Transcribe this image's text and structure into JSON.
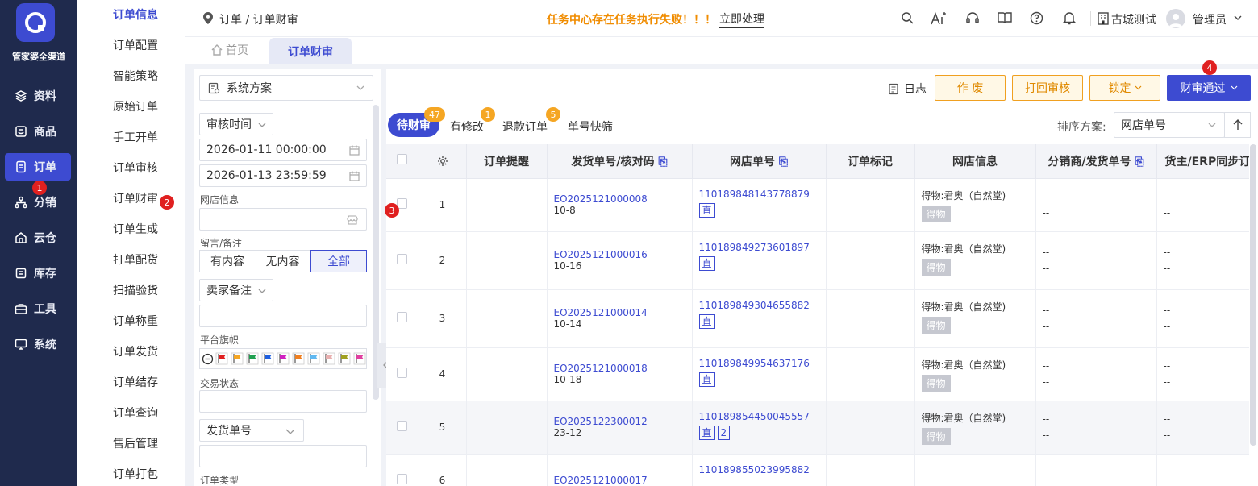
{
  "brand": {
    "name": "管家婆全渠道"
  },
  "nav": [
    {
      "label": "资料",
      "icon": "layers-icon"
    },
    {
      "label": "商品",
      "icon": "box-icon"
    },
    {
      "label": "订单",
      "icon": "document-icon",
      "active": true
    },
    {
      "label": "分销",
      "icon": "network-icon"
    },
    {
      "label": "云仓",
      "icon": "warehouse-icon"
    },
    {
      "label": "库存",
      "icon": "stack-icon"
    },
    {
      "label": "工具",
      "icon": "toolbox-icon"
    },
    {
      "label": "系统",
      "icon": "monitor-icon"
    }
  ],
  "badges": {
    "nav": "1",
    "submenu": "2",
    "row": "3",
    "approve": "4"
  },
  "submenu": [
    "订单信息",
    "订单配置",
    "智能策略",
    "原始订单",
    "手工开单",
    "订单审核",
    "订单财审",
    "订单生成",
    "打单配货",
    "扫描验货",
    "订单称重",
    "订单发货",
    "订单结存",
    "订单查询",
    "售后管理",
    "订单打包"
  ],
  "header": {
    "breadcrumb": "订单 / 订单财审",
    "alert": "任务中心存在任务执行失败！！！",
    "alert_action": "立即处理",
    "store": "古城测试",
    "user": "管理员"
  },
  "tabs": {
    "home": "首页",
    "current": "订单财审"
  },
  "filter": {
    "scheme": "系统方案",
    "time_type": "审核时间",
    "start": "2026-01-11 00:00:00",
    "end": "2026-01-13 23:59:59",
    "shop_label": "网店信息",
    "remark_label": "留言/备注",
    "remark_options": [
      "有内容",
      "无内容",
      "全部"
    ],
    "remark_selected": "全部",
    "seller_note": "卖家备注",
    "flag_label": "平台旗帜",
    "flag_colors": [
      "#e02020",
      "#f5a623",
      "#20a050",
      "#2060e0",
      "#d020c0",
      "#f08020",
      "#60b8f0",
      "#e8b0b0",
      "#a0a020",
      "#e040a0"
    ],
    "trade_label": "交易状态",
    "ship_no": "发货单号",
    "order_type_label": "订单类型"
  },
  "toolbar": {
    "log": "日志",
    "void": "作 废",
    "reject": "打回审核",
    "lock": "锁定",
    "approve": "财审通过"
  },
  "status_tabs": [
    {
      "label": "待财审",
      "count": "47",
      "active": true
    },
    {
      "label": "有修改",
      "count": "1"
    },
    {
      "label": "退款订单",
      "count": "5"
    },
    {
      "label": "单号快筛",
      "count": ""
    }
  ],
  "sort": {
    "label": "排序方案:",
    "value": "网店单号"
  },
  "table": {
    "columns": [
      "订单提醒",
      "发货单号/核对码",
      "网店单号",
      "订单标记",
      "网店信息",
      "分销商/发货单号",
      "货主/ERP同步订"
    ],
    "rows": [
      {
        "idx": "1",
        "ship": "EO2025121000008",
        "code": "10-8",
        "shop_no": "110189848143778879",
        "tags": [
          "直"
        ],
        "info": "得物:君奥（自然堂)",
        "platform": "得物",
        "dist": [
          "--",
          "--"
        ],
        "owner": [
          "--",
          "--"
        ]
      },
      {
        "idx": "2",
        "ship": "EO2025121000016",
        "code": "10-16",
        "shop_no": "110189849273601897",
        "tags": [
          "直"
        ],
        "info": "得物:君奥（自然堂)",
        "platform": "得物",
        "dist": [
          "--",
          "--"
        ],
        "owner": [
          "--",
          "--"
        ]
      },
      {
        "idx": "3",
        "ship": "EO2025121000014",
        "code": "10-14",
        "shop_no": "110189849304655882",
        "tags": [
          "直"
        ],
        "info": "得物:君奥（自然堂)",
        "platform": "得物",
        "dist": [
          "--",
          "--"
        ],
        "owner": [
          "--",
          "--"
        ]
      },
      {
        "idx": "4",
        "ship": "EO2025121000018",
        "code": "10-18",
        "shop_no": "110189849954637176",
        "tags": [
          "直"
        ],
        "info": "得物:君奥（自然堂)",
        "platform": "得物",
        "dist": [
          "--",
          "--"
        ],
        "owner": [
          "--",
          "--"
        ]
      },
      {
        "idx": "5",
        "ship": "EO2025122300012",
        "code": "23-12",
        "shop_no": "110189854450045557",
        "tags": [
          "直",
          "2"
        ],
        "info": "得物:君奥（自然堂)",
        "platform": "得物",
        "dist": [
          "--",
          "--"
        ],
        "owner": [
          "--",
          "--"
        ]
      },
      {
        "idx": "6",
        "ship": "EO2025121000017",
        "code": "",
        "shop_no": "110189855023995882",
        "tags": [],
        "info": "",
        "platform": "",
        "dist": [],
        "owner": []
      }
    ]
  },
  "colors": {
    "sidebar": "#1f2a4d",
    "accent": "#3d4bd1",
    "warning": "#f5a623",
    "badge": "#e02020"
  }
}
